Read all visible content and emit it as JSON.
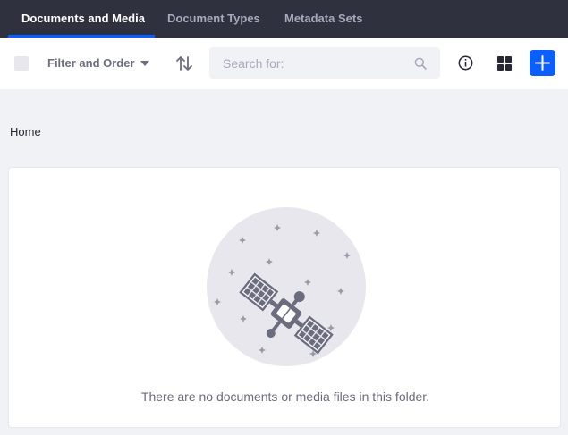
{
  "tabs": [
    {
      "label": "Documents and Media",
      "active": true
    },
    {
      "label": "Document Types",
      "active": false
    },
    {
      "label": "Metadata Sets",
      "active": false
    }
  ],
  "toolbar": {
    "filter_label": "Filter and Order",
    "search_placeholder": "Search for:",
    "icons": [
      "checkbox",
      "chevron-down-icon",
      "sort-icon",
      "search-icon",
      "info-icon",
      "cards-view-icon",
      "plus-icon"
    ]
  },
  "breadcrumb": {
    "current": "Home"
  },
  "empty_state": {
    "message": "There are no documents or media files in this folder.",
    "illustration": "satellite-icon"
  },
  "colors": {
    "topbar": "#30313f",
    "accent": "#0b5fff",
    "background": "#f1f2f5",
    "muted_text": "#6b6c7e"
  }
}
